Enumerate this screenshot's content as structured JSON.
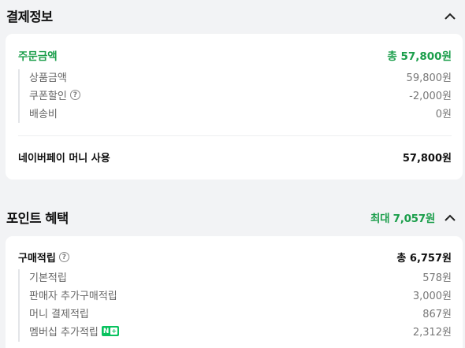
{
  "payment_info": {
    "title": "결제정보",
    "order_amount_label": "주문금액",
    "order_amount_value": "총 57,800원",
    "items": [
      {
        "label": "상품금액",
        "value": "59,800원"
      },
      {
        "label": "쿠폰할인",
        "value": "-2,000원"
      },
      {
        "label": "배송비",
        "value": "0원"
      }
    ],
    "naverpay_label": "네이버페이 머니 사용",
    "naverpay_value": "57,800원"
  },
  "point_benefit": {
    "title": "포인트 혜택",
    "max_label": "최대 7,057원",
    "purchase_label": "구매적립",
    "purchase_value": "총 6,757원",
    "items": [
      {
        "label": "기본적립",
        "value": "578원"
      },
      {
        "label": "판매자 추가구매적립",
        "value": "3,000원"
      },
      {
        "label": "머니 결제적립",
        "value": "867원"
      },
      {
        "label": "멤버십 추가적립",
        "value": "2,312원"
      }
    ],
    "membership_badge": "N+"
  },
  "icons": {
    "help": "?",
    "chevron": "chevron-up-icon"
  },
  "colors": {
    "accent_green": "#1b9e4b",
    "badge_green": "#08c25e",
    "background": "#f2f3f5"
  }
}
